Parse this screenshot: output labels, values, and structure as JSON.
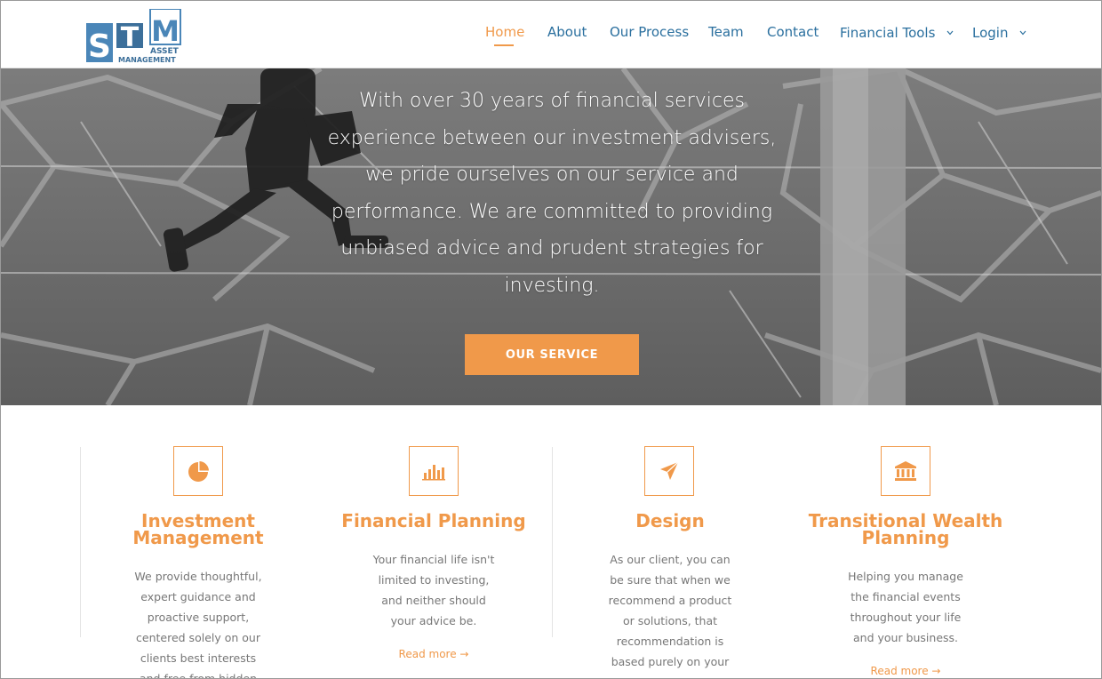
{
  "header": {
    "logo": {
      "letters": [
        "S",
        "T",
        "M"
      ],
      "line1": "ASSET",
      "line2": "MANAGEMENT"
    },
    "nav": [
      {
        "label": "Home",
        "active": true
      },
      {
        "label": "About"
      },
      {
        "label": "Our Process"
      },
      {
        "label": "Team"
      },
      {
        "label": "Contact"
      },
      {
        "label": "Financial Tools",
        "dropdown": true
      },
      {
        "label": "Login",
        "dropdown": true
      }
    ]
  },
  "hero": {
    "lines": [
      "With over 30 years of financial services",
      "experience between our investment advisers,",
      "we pride ourselves on our service and",
      "performance. We are committed to providing",
      "unbiased advice and prudent strategies for",
      "investing."
    ],
    "button_label": "OUR SERVICE"
  },
  "services": [
    {
      "icon": "pie-chart-icon",
      "title_lines": [
        "Investment",
        "Management"
      ],
      "text_lines": [
        "We provide thoughtful,",
        "expert guidance and",
        "proactive support,",
        "centered solely on our",
        "clients best interests",
        "and free from hidden"
      ],
      "read_more": ""
    },
    {
      "icon": "bar-chart-icon",
      "title_lines": [
        "Financial Planning"
      ],
      "text_lines": [
        "Your financial life isn't",
        "limited to investing,",
        "and neither should",
        "your advice be."
      ],
      "read_more": "Read more →"
    },
    {
      "icon": "paper-plane-icon",
      "title_lines": [
        "Design"
      ],
      "text_lines": [
        "As our client, you can",
        "be sure that when we",
        "recommend a product",
        "or solutions, that",
        "recommendation is",
        "based purely on your"
      ],
      "read_more": ""
    },
    {
      "icon": "bank-icon",
      "title_lines": [
        "Transitional Wealth",
        "Planning"
      ],
      "text_lines": [
        "Helping you manage",
        "the financial events",
        "throughout your life",
        "and your business."
      ],
      "read_more": "Read more →"
    }
  ],
  "colors": {
    "accent": "#f0994a",
    "nav": "#2a6f9e",
    "logo_blue": "#4a86b8",
    "body_text": "#777777"
  }
}
